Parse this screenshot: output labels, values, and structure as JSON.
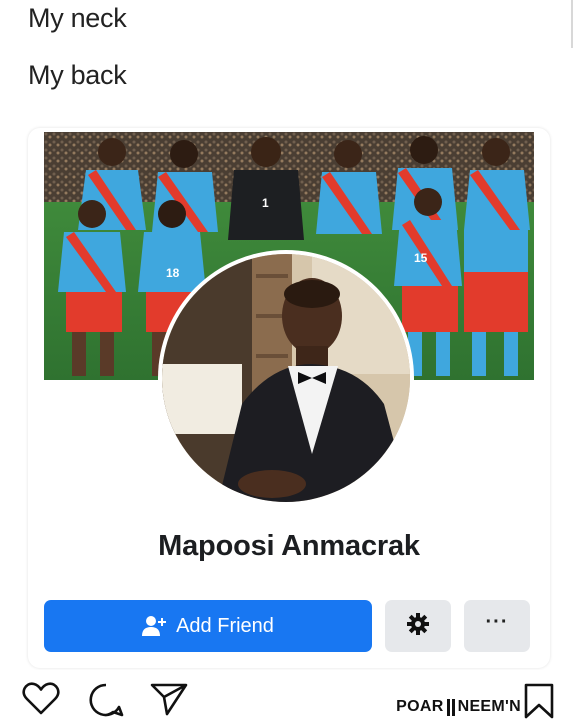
{
  "caption": {
    "line1": "My neck",
    "line2": "My back"
  },
  "profile": {
    "name": "Mapoosi Anmacrak",
    "add_friend_label": "Add Friend",
    "more_label": "···"
  },
  "icons": {
    "add_friend": "add-person-icon",
    "settings": "gear-icon",
    "more": "more-dots-icon",
    "like": "heart-icon",
    "comment": "comment-bubble-icon",
    "share": "send-icon",
    "save": "bookmark-icon"
  },
  "watermark": {
    "left": "POAR",
    "right": "NEEM'N"
  },
  "colors": {
    "accent": "#1877f2",
    "secondary_button": "#e6e8eb",
    "jersey_blue": "#3fa7de",
    "jersey_red": "#e23b2c"
  }
}
